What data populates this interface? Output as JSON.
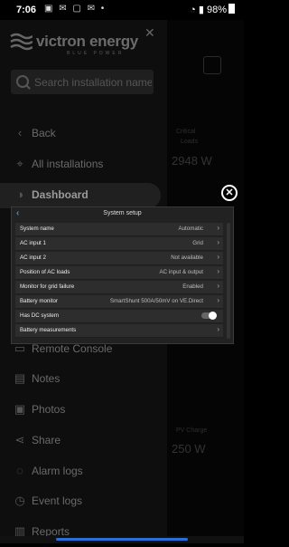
{
  "status_bar": {
    "time": "7:06",
    "battery": "98%"
  },
  "drawer": {
    "brand": "victron energy",
    "tagline": "BLUE POWER",
    "search_placeholder": "Search installation name",
    "items": [
      {
        "label": "Back",
        "icon": "chevron-left-icon"
      },
      {
        "label": "All installations",
        "icon": "location-pin-icon"
      },
      {
        "label": "Dashboard",
        "icon": "gauge-icon",
        "active": true
      },
      {
        "label": "Remote Console",
        "icon": "console-icon"
      },
      {
        "label": "Notes",
        "icon": "note-icon"
      },
      {
        "label": "Photos",
        "icon": "photo-icon"
      },
      {
        "label": "Share",
        "icon": "share-icon"
      },
      {
        "label": "Alarm logs",
        "icon": "alarm-icon"
      },
      {
        "label": "Event logs",
        "icon": "event-icon"
      },
      {
        "label": "Reports",
        "icon": "reports-icon"
      }
    ]
  },
  "background": {
    "label1": "Critical",
    "label2": "Loads",
    "value": "2948 W",
    "charge_label": "PV Charge",
    "charge_value": "250 W"
  },
  "modal": {
    "title": "System setup",
    "rows": [
      {
        "key": "System name",
        "value": "Automatic"
      },
      {
        "key": "AC input 1",
        "value": "Grid"
      },
      {
        "key": "AC input 2",
        "value": "Not available"
      },
      {
        "key": "Position of AC loads",
        "value": "AC input & output"
      },
      {
        "key": "Monitor for grid failure",
        "value": "Enabled"
      },
      {
        "key": "Battery monitor",
        "value": "SmartShunt 500A/50mV on VE.Direct"
      },
      {
        "key": "Has DC system",
        "value": "",
        "toggle": true,
        "toggle_on": false
      },
      {
        "key": "Battery measurements",
        "value": ""
      }
    ]
  }
}
